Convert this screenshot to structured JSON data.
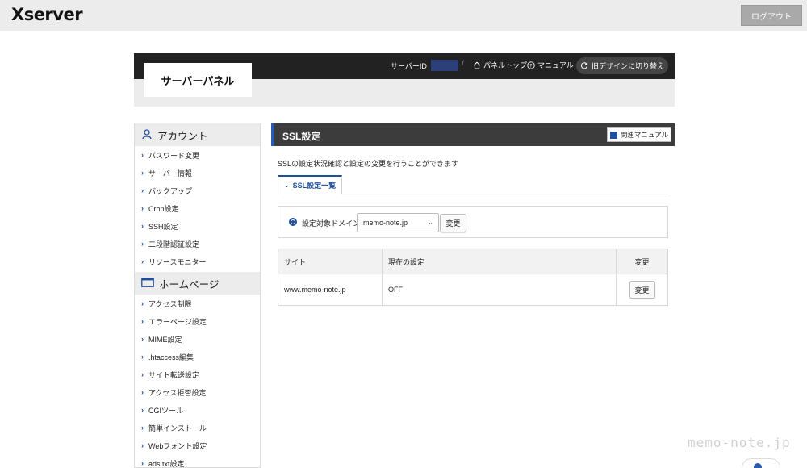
{
  "header": {
    "logo": "Xserver",
    "logout_label": "ログアウト"
  },
  "panel": {
    "title": "サーバーパネル",
    "server_id_label": "サーバーID",
    "separator": "/",
    "panel_top_label": "パネルトップ",
    "manual_label": "マニュアル",
    "old_design_label": "旧デザインに切り替え"
  },
  "sidebar": {
    "sections": [
      {
        "title": "アカウント",
        "icon": "user-icon",
        "items": [
          {
            "label": "パスワード変更"
          },
          {
            "label": "サーバー情報"
          },
          {
            "label": "バックアップ"
          },
          {
            "label": "Cron設定"
          },
          {
            "label": "SSH設定"
          },
          {
            "label": "二段階認証設定"
          },
          {
            "label": "リソースモニター"
          }
        ]
      },
      {
        "title": "ホームページ",
        "icon": "window-icon",
        "items": [
          {
            "label": "アクセス制限"
          },
          {
            "label": "エラーページ設定"
          },
          {
            "label": "MIME設定"
          },
          {
            "label": ".htaccess編集"
          },
          {
            "label": "サイト転送設定"
          },
          {
            "label": "アクセス拒否設定"
          },
          {
            "label": "CGIツール"
          },
          {
            "label": "簡単インストール"
          },
          {
            "label": "Webフォント設定"
          },
          {
            "label": "ads.txt設定"
          }
        ]
      }
    ]
  },
  "main": {
    "title": "SSL設定",
    "manual_button": "関連マニュアル",
    "description": "SSLの設定状況確認と設定の変更を行うことができます",
    "tab_label": "SSL設定一覧",
    "domain": {
      "label": "設定対象ドメイン",
      "selected": "memo-note.jp",
      "change_button": "変更"
    },
    "table": {
      "headers": [
        "サイト",
        "現在の設定",
        "変更"
      ],
      "rows": [
        {
          "site": "www.memo-note.jp",
          "setting": "OFF",
          "button": "変更"
        }
      ]
    }
  },
  "watermark": "memo-note.jp",
  "colors": {
    "accent": "#1e4e9c",
    "header_dark": "#222222",
    "server_id_mask": "#2d3f78"
  }
}
